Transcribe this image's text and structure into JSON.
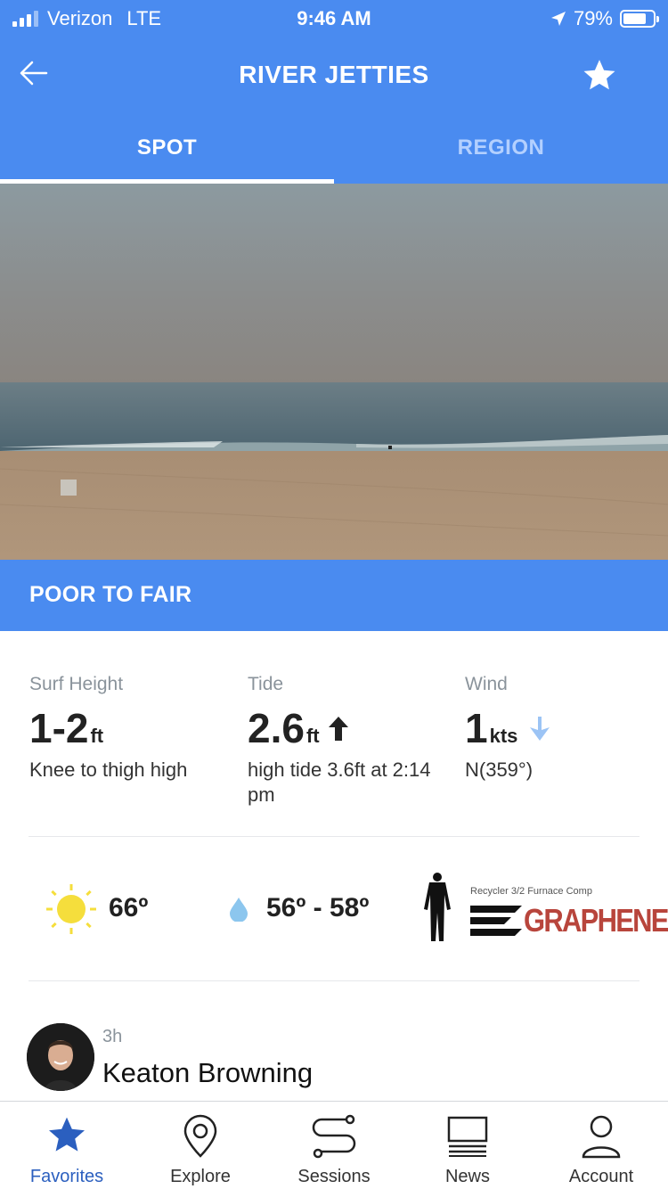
{
  "status_bar": {
    "carrier": "Verizon",
    "network": "LTE",
    "time": "9:46 AM",
    "battery": "79%",
    "battery_level": 0.79
  },
  "header": {
    "title": "RIVER JETTIES",
    "back_icon": "arrow-left-icon",
    "favorite_icon": "star-icon"
  },
  "tabs": [
    {
      "label": "SPOT",
      "active": true
    },
    {
      "label": "REGION",
      "active": false
    }
  ],
  "condition": "POOR TO FAIR",
  "stats": {
    "surf": {
      "label": "Surf Height",
      "value": "1-2",
      "unit": "ft",
      "desc": "Knee to thigh high"
    },
    "tide": {
      "label": "Tide",
      "value": "2.6",
      "unit": "ft",
      "desc": "high tide 3.6ft at 2:14 pm",
      "trend_icon": "arrow-up-icon"
    },
    "wind": {
      "label": "Wind",
      "value": "1",
      "unit": "kts",
      "desc": "N(359°)",
      "direction_icon": "arrow-down-icon"
    }
  },
  "weather": {
    "air_temp": "66º",
    "water_temp": "56º - 58º",
    "air_icon": "sun-icon",
    "water_icon": "water-drop-icon"
  },
  "sponsor": {
    "product": "Recycler 3/2 Furnace Comp",
    "brand": "GRAPHENE"
  },
  "reporter": {
    "time": "3h",
    "name": "Keaton Browning"
  },
  "bottom_nav": [
    {
      "label": "Favorites",
      "icon": "star-icon",
      "active": true
    },
    {
      "label": "Explore",
      "icon": "map-pin-icon",
      "active": false
    },
    {
      "label": "Sessions",
      "icon": "route-icon",
      "active": false
    },
    {
      "label": "News",
      "icon": "newspaper-icon",
      "active": false
    },
    {
      "label": "Account",
      "icon": "user-icon",
      "active": false
    }
  ],
  "colors": {
    "primary": "#4a8bf0",
    "active_nav": "#2b5fbf"
  }
}
